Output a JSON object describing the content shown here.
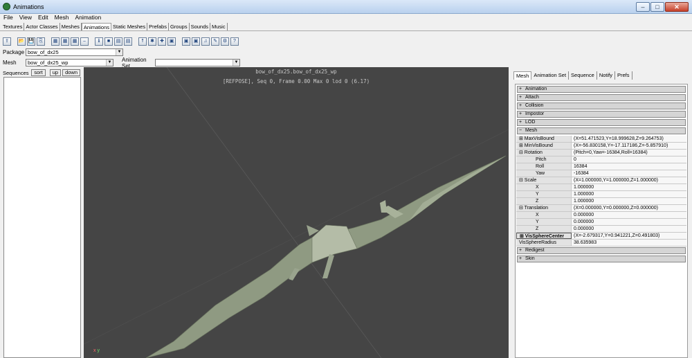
{
  "window": {
    "title": "Animations",
    "minimize": "–",
    "maximize": "□",
    "close": "✕"
  },
  "menu": [
    "File",
    "View",
    "Edit",
    "Mesh",
    "Animation"
  ],
  "tabs": [
    "Textures",
    "Actor Classes",
    "Meshes",
    "Animations",
    "Static Meshes",
    "Prefabs",
    "Groups",
    "Sounds",
    "Music"
  ],
  "active_tab": "Animations",
  "toolbar_icons": [
    "import-icon",
    "open-icon",
    "save-icon",
    "copy-icon",
    "anim-icon-1",
    "anim-icon-2",
    "anim-icon-3",
    "link-icon",
    "info-icon",
    "book-icon",
    "grid-icon",
    "grid2-icon",
    "actor-icon",
    "bone-icon",
    "bone2-icon",
    "frame-icon",
    "mesh-icon",
    "mesh2-icon",
    "sound-icon",
    "notify-icon",
    "prefs-icon",
    "help-icon"
  ],
  "package": {
    "label": "Package",
    "value": "bow_of_dx25"
  },
  "mesh": {
    "label": "Mesh",
    "value": "bow_of_dx25_wp"
  },
  "animset": {
    "label": "Animation Set",
    "value": ""
  },
  "sequences": {
    "label": "Sequences",
    "sort": "sort",
    "up": "up",
    "down": "down"
  },
  "viewport": {
    "title": "bow_of_dx25.bow_of_dx25_wp",
    "info": "[REFPOSE], Seq 0,  Frame  0.00 Max 0  lod 0 (6.17)",
    "axis_x": "x",
    "axis_y": "y"
  },
  "panel_tabs": [
    "Mesh",
    "Animation Set",
    "Sequence",
    "Notify",
    "Prefs"
  ],
  "categories_top": [
    {
      "pm": "+",
      "name": "Animation"
    },
    {
      "pm": "+",
      "name": "Attach"
    },
    {
      "pm": "+",
      "name": "Collision"
    },
    {
      "pm": "+",
      "name": "Impostor"
    },
    {
      "pm": "+",
      "name": "LOD"
    },
    {
      "pm": "−",
      "name": "Mesh"
    }
  ],
  "props": [
    {
      "k": "⊞ MaxVisBound",
      "v": "(X=51.471523,Y=18.999628,Z=9.264753)"
    },
    {
      "k": "⊞ MinVisBound",
      "v": "(X=-56.830158,Y=-17.117186,Z=-5.857910)"
    },
    {
      "k": "⊟ Rotation",
      "v": "(Pitch=0,Yaw=-16384,Roll=16384)"
    },
    {
      "k": "Pitch",
      "v": "0"
    },
    {
      "k": "Roll",
      "v": "16384"
    },
    {
      "k": "Yaw",
      "v": "-16384"
    },
    {
      "k": "⊟ Scale",
      "v": "(X=1.000000,Y=1.000000,Z=1.000000)"
    },
    {
      "k": "X",
      "v": "1.000000"
    },
    {
      "k": "Y",
      "v": "1.000000"
    },
    {
      "k": "Z",
      "v": "1.000000"
    },
    {
      "k": "⊟ Translation",
      "v": "(X=0.000000,Y=0.000000,Z=0.000000)"
    },
    {
      "k": "X",
      "v": "0.000000"
    },
    {
      "k": "Y",
      "v": "0.000000"
    },
    {
      "k": "Z",
      "v": "0.000000"
    },
    {
      "k": "⊞ VisSphereCenter",
      "v": "(X=-2.679317,Y=0.941221,Z=0.491803)"
    },
    {
      "k": "VisSphereRadius",
      "v": "38.635983"
    }
  ],
  "categories_bottom": [
    {
      "pm": "+",
      "name": "Redigest"
    },
    {
      "pm": "+",
      "name": "Skin"
    }
  ],
  "colors": {
    "viewport_bg": "#454545",
    "mesh_fill": "#8f9a82"
  }
}
